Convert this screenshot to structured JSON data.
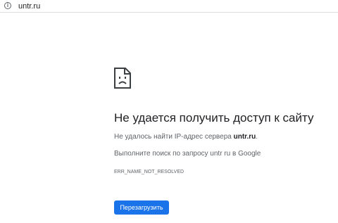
{
  "address_bar": {
    "url": "untr.ru",
    "info_icon": "info-icon"
  },
  "error_page": {
    "icon": "sad-page-icon",
    "title": "Не удается получить доступ к сайту",
    "dns_message_prefix": "Не удалось найти IP-адрес сервера ",
    "dns_message_host": "untr.ru",
    "dns_message_suffix": ".",
    "search_suggestion": "Выполните поиск по запросу untr ru в Google",
    "error_code": "ERR_NAME_NOT_RESOLVED",
    "reload_label": "Перезагрузить"
  },
  "colors": {
    "button": "#1a73e8",
    "title": "#202124",
    "text": "#5f6368"
  }
}
